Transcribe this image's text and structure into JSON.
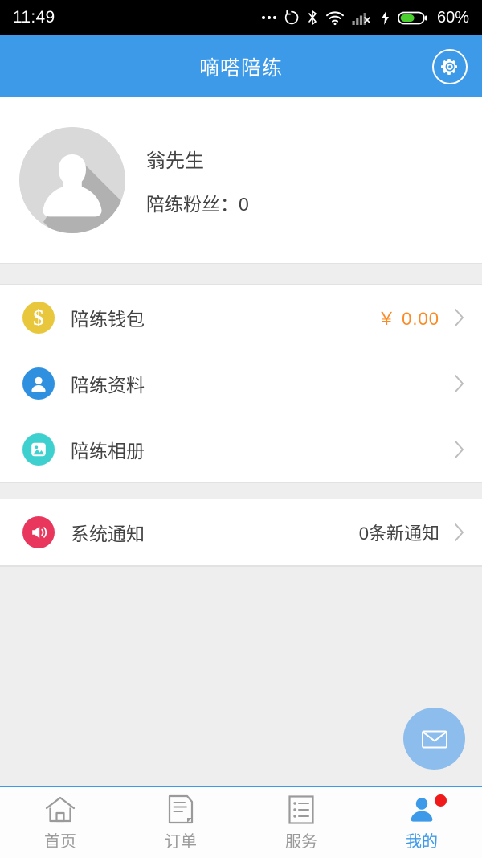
{
  "status_bar": {
    "time": "11:49",
    "battery_percent": "60%",
    "icons": [
      "more-dots-icon",
      "rotate-circle-icon",
      "bluetooth-icon",
      "wifi-icon",
      "signal-bars-icon",
      "charging-bolt-icon",
      "battery-icon"
    ]
  },
  "header": {
    "title": "嘀嗒陪练",
    "settings_icon": "gear-icon",
    "background_color": "#3c9ae8"
  },
  "profile": {
    "avatar_icon": "user-avatar-placeholder-icon",
    "name": "翁先生",
    "fans": "陪练粉丝：0"
  },
  "menu_groups": [
    {
      "rows": [
        {
          "id": "wallet",
          "icon": "dollar-coin-icon",
          "icon_color": "#e8c73d",
          "label": "陪练钱包",
          "value": "￥ 0.00",
          "value_color": "#fa8c28",
          "chevron": "chevron-right-icon"
        },
        {
          "id": "profile-info",
          "icon": "person-icon",
          "icon_color": "#2f90e0",
          "label": "陪练资料",
          "value": "",
          "chevron": "chevron-right-icon"
        },
        {
          "id": "album",
          "icon": "photo-icon",
          "icon_color": "#3ed0ce",
          "label": "陪练相册",
          "value": "",
          "chevron": "chevron-right-icon"
        }
      ]
    },
    {
      "rows": [
        {
          "id": "system-notice",
          "icon": "speaker-horn-icon",
          "icon_color": "#e8365c",
          "label": "系统通知",
          "value": "0条新通知",
          "value_color": "#444444",
          "chevron": "chevron-right-icon"
        }
      ]
    }
  ],
  "fab": {
    "icon": "envelope-icon",
    "color": "#8cbdec"
  },
  "tabbar": {
    "active_color": "#3c9ae8",
    "inactive_color": "#9a9a9a",
    "items": [
      {
        "id": "home",
        "icon": "home-icon",
        "label": "首页",
        "active": false,
        "badge": false
      },
      {
        "id": "orders",
        "icon": "document-icon",
        "label": "订单",
        "active": false,
        "badge": false
      },
      {
        "id": "service",
        "icon": "list-icon",
        "label": "服务",
        "active": false,
        "badge": false
      },
      {
        "id": "mine",
        "icon": "person-icon",
        "label": "我的",
        "active": true,
        "badge": true
      }
    ]
  }
}
